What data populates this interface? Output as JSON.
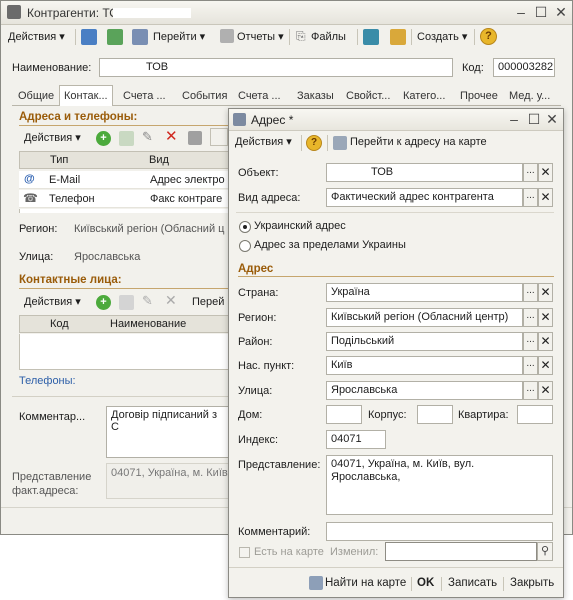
{
  "main": {
    "title": "Контрагенти: ТОВ *",
    "toolbar": {
      "actions": "Действия",
      "go": "Перейти",
      "reports": "Отчеты",
      "files": "Файлы",
      "create": "Создать"
    },
    "name_label": "Наименование:",
    "name_value": "ТОВ",
    "code_label": "Код:",
    "code_value": "000003282",
    "tabs": [
      "Общие",
      "Контак...",
      "Счета ...",
      "События",
      "Счета ...",
      "Заказы",
      "Свойст...",
      "Катего...",
      "Прочее",
      "Мед. у..."
    ],
    "addresses_title": "Адреса и телефоны:",
    "addr_actions": "Действия",
    "grid_cols": [
      "Тип",
      "Вид"
    ],
    "grid_rows": [
      {
        "type": "E-Mail",
        "kind": "Адрес электро"
      },
      {
        "type": "Телефон",
        "kind": "Факс контраге"
      }
    ],
    "region_label": "Регион:",
    "region_value": "Київський регіон (Обласний ц",
    "street_label": "Улица:",
    "street_value": "Ярославська",
    "contacts_title": "Контактные лица:",
    "contacts_actions": "Действия",
    "contacts_go": "Перей",
    "contacts_cols": [
      "Код",
      "Наименование"
    ],
    "phones_label": "Телефоны:",
    "comment_label": "Комментар...",
    "comment_value": "Договір підписаний з С",
    "repr_label_1": "Представление",
    "repr_label_2": "факт.адреса:",
    "repr_value": "04071, Україна, м. Київ"
  },
  "dialog": {
    "title": "Адрес *",
    "actions": "Действия",
    "goto_map": "Перейти к адресу на карте",
    "object_label": "Объект:",
    "object_value": "ТОВ",
    "type_label": "Вид адреса:",
    "type_value": "Фактический адрес контрагента",
    "radio_ua": "Украинский адрес",
    "radio_foreign": "Адрес за пределами Украины",
    "address_section": "Адрес",
    "country_label": "Страна:",
    "country_value": "Україна",
    "region_label": "Регион:",
    "region_value": "Київський регіон (Обласний центр)",
    "district_label": "Район:",
    "district_value": "Подільський",
    "city_label": "Нас. пункт:",
    "city_value": "Київ",
    "street_label": "Улица:",
    "street_value": "Ярославська",
    "house_label": "Дом:",
    "house_value": "",
    "building_label": "Корпус:",
    "building_value": "",
    "apt_label": "Квартира:",
    "apt_value": "",
    "index_label": "Индекс:",
    "index_value": "04071",
    "repr_label": "Представление:",
    "repr_line1": "04071, Україна, м. Київ, вул.",
    "repr_line2": "Ярославська,",
    "comment_label": "Комментарий:",
    "comment_value": "",
    "on_map_label": "Есть на карте",
    "changed_label": "Изменил:",
    "changed_value": "",
    "find_on_map": "Найти на карте",
    "ok": "OK",
    "save": "Записать",
    "close": "Закрыть"
  }
}
